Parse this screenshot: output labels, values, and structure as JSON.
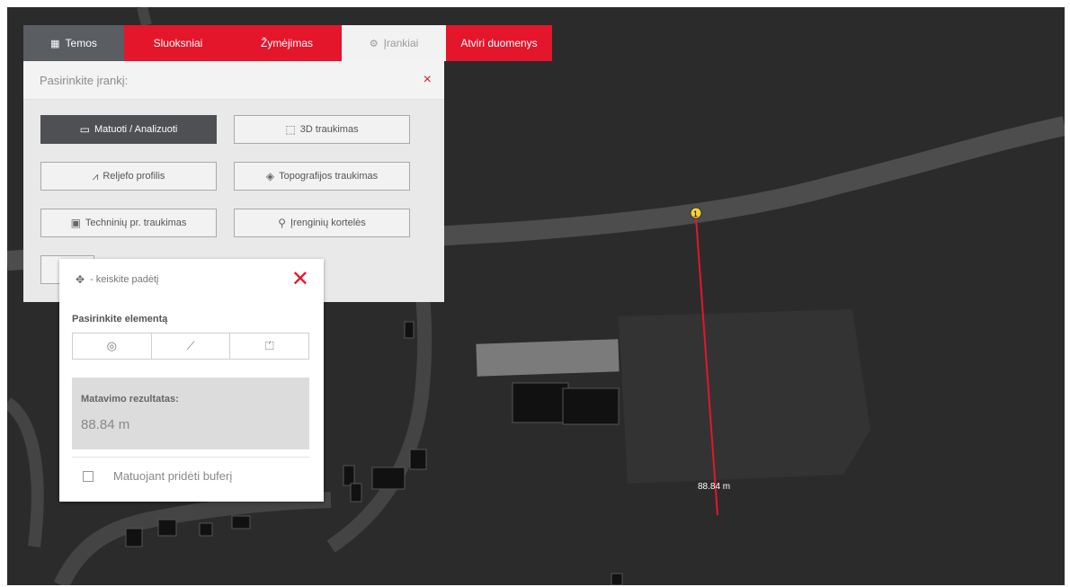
{
  "tabs": {
    "temos": "Temos",
    "sluoksniai": "Sluoksniai",
    "zymejimas": "Žymėjimas",
    "irankiai": "Įrankiai",
    "atviri": "Atviri duomenys"
  },
  "tools_panel": {
    "title": "Pasirinkite įrankį:",
    "close_icon": "×",
    "buttons": {
      "matuoti": "Matuoti / Analizuoti",
      "trauk3d": "3D traukimas",
      "reljefo": "Reljefo profilis",
      "topo": "Topografijos traukimas",
      "techniniu": "Techninių pr. traukimas",
      "irenginiu": "Įrenginių kortelės"
    }
  },
  "measure_panel": {
    "move_hint": "- keiskite padėtį",
    "select_label": "Pasirinkite elementą",
    "result_label": "Matavimo rezultatas:",
    "result_value": "88.84 m",
    "buffer_label": "Matuojant pridėti buferį"
  },
  "map": {
    "measure_label": "88.84 m",
    "marker_number": "1",
    "line_color": "#e4162b",
    "accent_color": "#e4162b"
  }
}
